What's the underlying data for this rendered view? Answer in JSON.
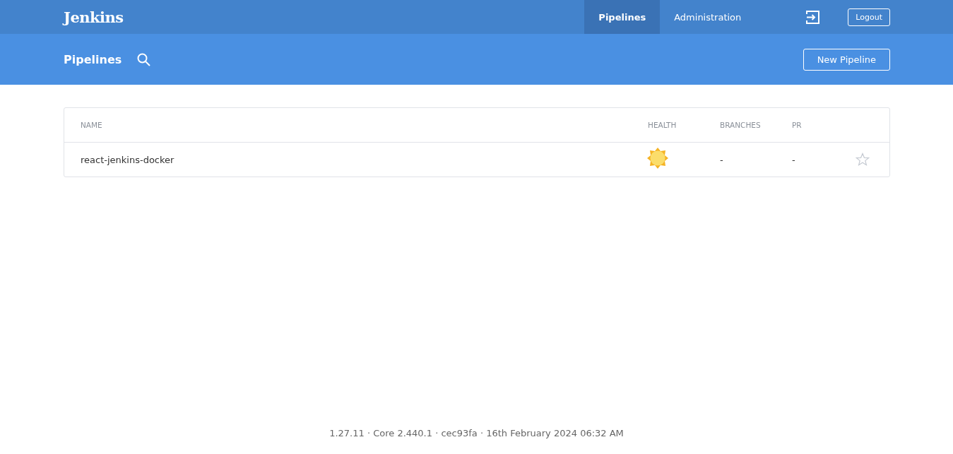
{
  "header": {
    "logo": "Jenkins",
    "nav": [
      {
        "label": "Pipelines",
        "selected": true
      },
      {
        "label": "Administration",
        "selected": false
      }
    ],
    "logout": "Logout"
  },
  "subheader": {
    "title": "Pipelines",
    "new_button": "New Pipeline"
  },
  "table": {
    "columns": [
      "NAME",
      "HEALTH",
      "BRANCHES",
      "PR"
    ],
    "rows": [
      {
        "name": "react-jenkins-docker",
        "health": {
          "kind": "sunny"
        },
        "branches": "-",
        "pr": "-",
        "favorite": false
      }
    ]
  },
  "footer": "1.27.11 · Core 2.440.1 · cec93fa · 16th February 2024 06:32 AM"
}
